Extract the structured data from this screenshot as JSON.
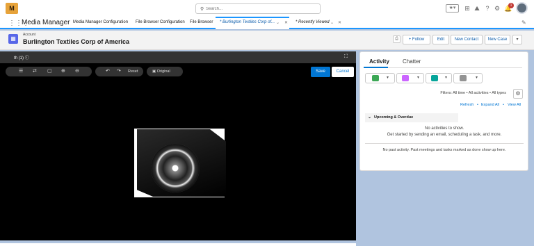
{
  "topbar": {
    "logo_text": "M",
    "search_placeholder": "Search...",
    "help_icon": "?",
    "notification_count": "1"
  },
  "nav": {
    "app_name": "Media Manager",
    "items": [
      "Media Manager Configuration",
      "File Browser Configuration",
      "File Browser"
    ],
    "active_tab": "* Burlington Textiles Corp of...",
    "recent_tab": "* Recently Viewed"
  },
  "record": {
    "type": "Account",
    "name": "Burlington Textiles Corp of America",
    "buttons": [
      "Follow",
      "Edit",
      "New Contact",
      "New Case"
    ]
  },
  "viewer": {
    "title": "th (1)",
    "reset_label": "Reset",
    "original_label": "Original",
    "save_label": "Save",
    "cancel_label": "Cancel"
  },
  "activity": {
    "tabs": [
      "Activity",
      "Chatter"
    ],
    "filters": "Filters: All time • All activities • All types",
    "links": [
      "Refresh",
      "Expand All",
      "View All"
    ],
    "upcoming_title": "Upcoming & Overdue",
    "no_activities_line1": "No activities to show.",
    "no_activities_line2": "Get started by sending an email, scheduling a task, and more.",
    "no_past": "No past activity. Past meetings and tasks marked as done show up here."
  },
  "colors": {
    "brand": "#0176d3",
    "active_tab_border": "#1b96ff",
    "account_icon": "#5867e8"
  }
}
